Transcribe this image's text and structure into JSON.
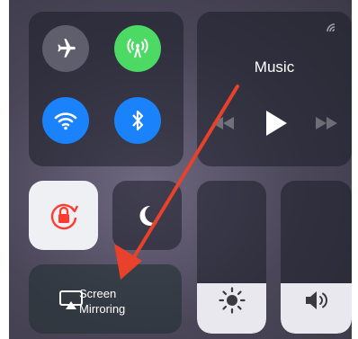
{
  "connectivity": {
    "airplane_icon": "airplane-icon",
    "cellular_icon": "cellular-antenna-icon",
    "wifi_icon": "wifi-icon",
    "bluetooth_icon": "bluetooth-icon",
    "cellular_active_color": "#4cd964",
    "wifi_active_color": "#1a82fb",
    "bluetooth_active_color": "#1a82fb",
    "airplane_active": false,
    "cellular_active": true,
    "wifi_active": true,
    "bluetooth_active": true
  },
  "music": {
    "title": "Music",
    "airplay_icon": "airplay-audio-icon",
    "previous_icon": "previous-track-icon",
    "play_icon": "play-icon",
    "next_icon": "next-track-icon"
  },
  "toggles": {
    "orientation_lock_icon": "orientation-lock-icon",
    "orientation_lock_color": "#ff3b30",
    "orientation_lock_active": true,
    "do_not_disturb_icon": "moon-icon",
    "do_not_disturb_active": false
  },
  "screen_mirroring": {
    "line1": "Screen",
    "line2": "Mirroring",
    "icon": "screen-mirroring-icon"
  },
  "brightness": {
    "icon": "sun-icon",
    "level": 0.33
  },
  "volume": {
    "icon": "speaker-icon",
    "level": 0.33
  },
  "annotation": {
    "arrow_color": "#e8412c"
  }
}
